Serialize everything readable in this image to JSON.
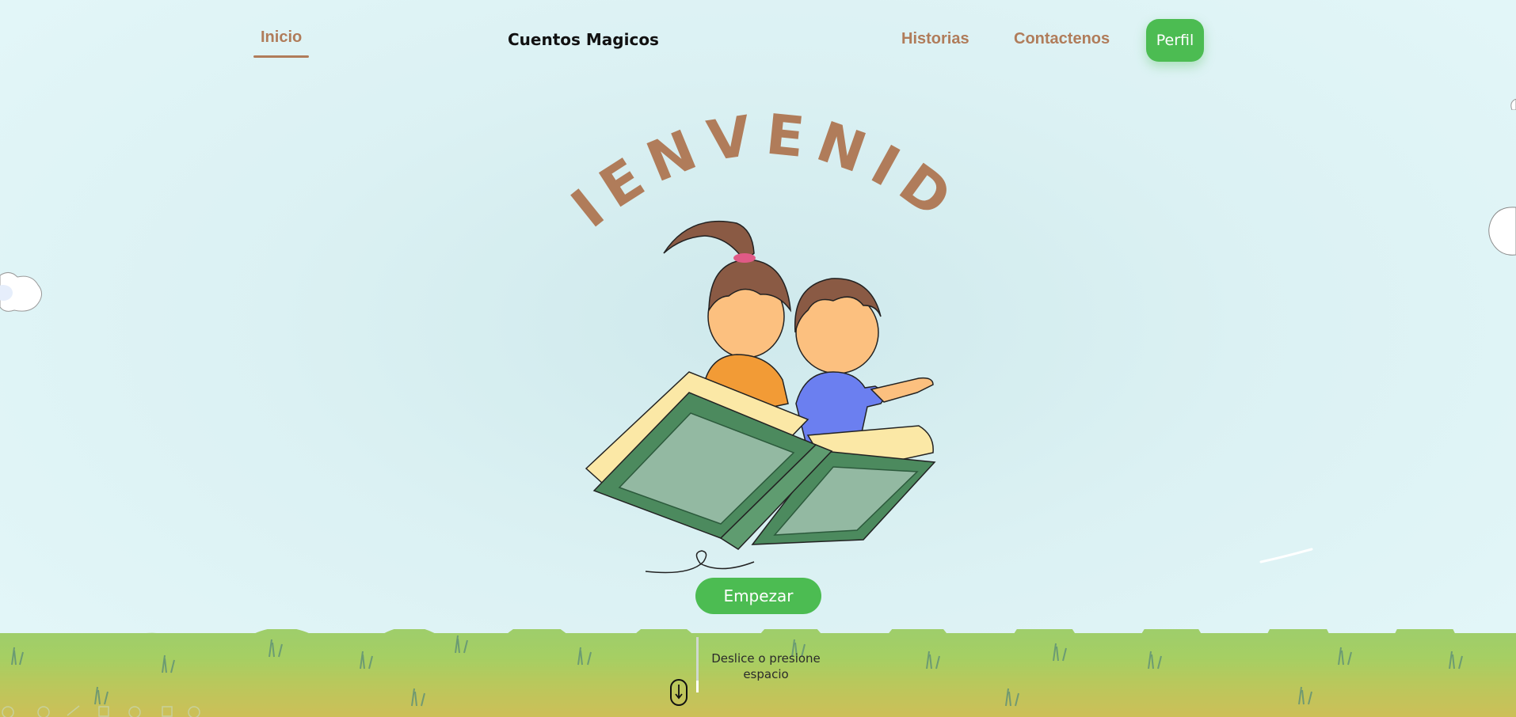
{
  "nav": {
    "home": "Inicio",
    "brand": "Cuentos Magicos",
    "stories": "Historias",
    "contact": "Contactenos",
    "profile": "Perfil"
  },
  "hero": {
    "title": "BIENVENIDO",
    "start_button": "Empezar"
  },
  "scroll_hint": "Deslice o presione espacio",
  "colors": {
    "accent_green": "#4cbc52",
    "brown": "#b07c5a",
    "sky": "#dbf1f3"
  }
}
